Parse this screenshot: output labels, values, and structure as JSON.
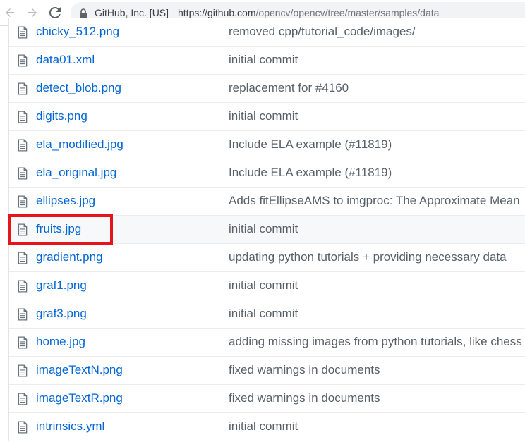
{
  "browser": {
    "cert_label": "GitHub, Inc. [US]",
    "url_host": "https://github.com",
    "url_path": "/opencv/opencv/tree/master/samples/data"
  },
  "files": [
    {
      "name": "chicky_512.png",
      "commit": "removed cpp/tutorial_code/images/"
    },
    {
      "name": "data01.xml",
      "commit": "initial commit"
    },
    {
      "name": "detect_blob.png",
      "commit": "replacement for #4160"
    },
    {
      "name": "digits.png",
      "commit": "initial commit"
    },
    {
      "name": "ela_modified.jpg",
      "commit": "Include ELA example (#11819)"
    },
    {
      "name": "ela_original.jpg",
      "commit": "Include ELA example (#11819)"
    },
    {
      "name": "ellipses.jpg",
      "commit": "Adds fitEllipseAMS to imgproc: The Approximate Mean"
    },
    {
      "name": "fruits.jpg",
      "commit": "initial commit"
    },
    {
      "name": "gradient.png",
      "commit": "updating python tutorials + providing necessary data"
    },
    {
      "name": "graf1.png",
      "commit": "initial commit"
    },
    {
      "name": "graf3.png",
      "commit": "initial commit"
    },
    {
      "name": "home.jpg",
      "commit": "adding missing images from python tutorials, like chess"
    },
    {
      "name": "imageTextN.png",
      "commit": "fixed warnings in documents"
    },
    {
      "name": "imageTextR.png",
      "commit": "fixed warnings in documents"
    },
    {
      "name": "intrinsics.yml",
      "commit": "initial commit"
    }
  ],
  "colors": {
    "link": "#0366d6",
    "commit_text": "#586069",
    "highlight": "#e8141c",
    "hover_row": "#f6f8fa"
  }
}
